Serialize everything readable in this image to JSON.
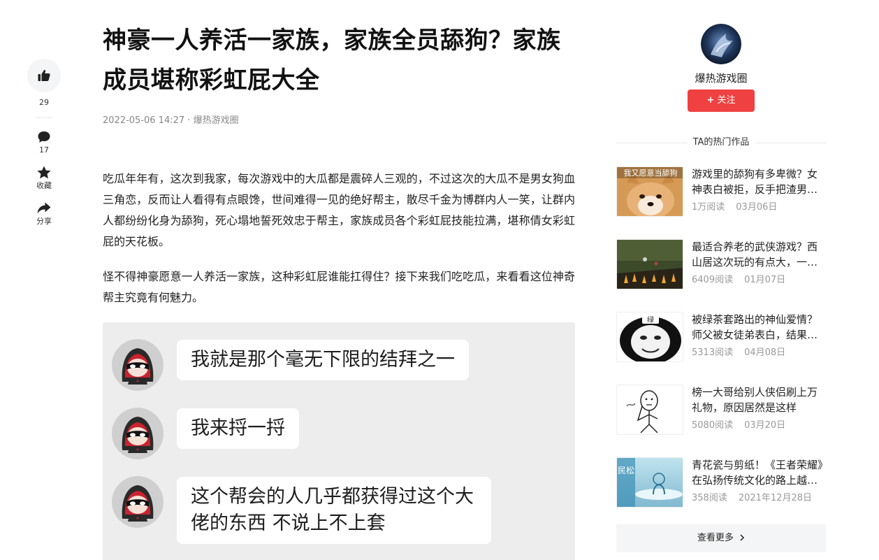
{
  "rail": {
    "like_count": "29",
    "comment_count": "17",
    "favorite_label": "收藏",
    "share_label": "分享"
  },
  "article": {
    "title": "神豪一人养活一家族，家族全员舔狗？家族成员堪称彩虹屁大全",
    "date": "2022-05-06 14:27",
    "separator": " · ",
    "author": "爆热游戏圈",
    "paragraphs": [
      "吃瓜年年有，这次到我家，每次游戏中的大瓜都是震碎人三观的，不过这次的大瓜不是男女狗血三角恋，反而让人看得有点眼馋，世间难得一见的绝好帮主，散尽千金为博群内人一笑，让群内人都纷纷化身为舔狗，死心塌地誓死效忠于帮主，家族成员各个彩虹屁技能拉满，堪称倩女彩虹屁的天花板。",
      "怪不得神豪愿意一人养活一家族，这种彩虹屁谁能扛得住？接下来我们吃吃瓜，来看看这位神奇帮主究竟有何魅力。"
    ],
    "chat_messages": [
      "我就是那个毫无下限的结拜之一",
      "我来捋一捋",
      "这个帮会的人几乎都获得过这个大佬的东西  不说上不上套"
    ]
  },
  "sidebar": {
    "author_name": "爆热游戏圈",
    "follow_label": "关注",
    "follow_icon": "plus-icon",
    "hot_heading": "TA的热门作品",
    "hot_items": [
      {
        "title": "游戏里的舔狗有多卑微？女神表白被拒，反手把渣男送进监狱",
        "reads": "1万阅读",
        "date": "03月06日",
        "thumb_text": "我又愿意当舔狗"
      },
      {
        "title": "最适合养老的武侠游戏？西山居这次玩的有点大，一个人也能玩",
        "reads": "6409阅读",
        "date": "01月07日"
      },
      {
        "title": "被绿茶套路出的神仙爱情？师父被女徒弟表白，结果尴尬了",
        "reads": "5313阅读",
        "date": "04月08日",
        "thumb_text": "绿"
      },
      {
        "title": "榜一大哥给别人侠侣刷上万礼物，原因居然是这样",
        "reads": "5080阅读",
        "date": "03月20日"
      },
      {
        "title": "青花瓷与剪纸！《王者荣耀》在弘扬传统文化的路上越走越远",
        "reads": "358阅读",
        "date": "2021年12月28日",
        "thumb_text": "民松"
      }
    ],
    "more_label": "查看更多"
  }
}
